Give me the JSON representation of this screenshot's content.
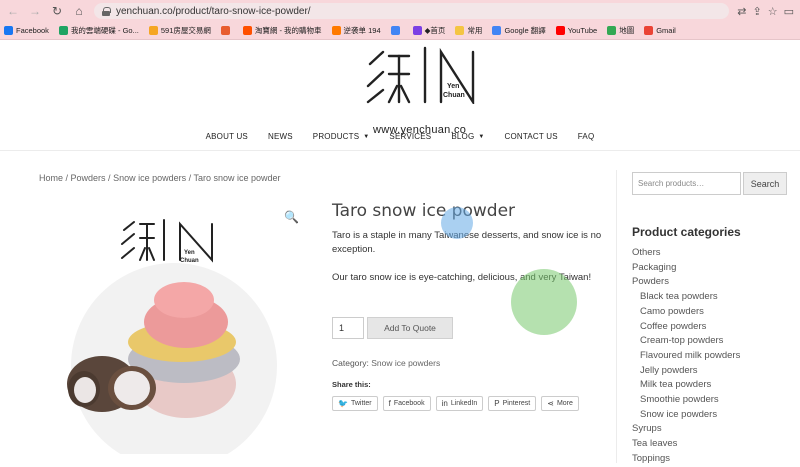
{
  "browser": {
    "url": "yenchuan.co/product/taro-snow-ice-powder/",
    "bookmarks": [
      {
        "label": "Facebook",
        "color": "#1877f2"
      },
      {
        "label": "我的雲端硬碟 - Go...",
        "color": "#1fa463"
      },
      {
        "label": "591房屋交易網",
        "color": "#f5a623"
      },
      {
        "label": "",
        "color": "#e85d2f"
      },
      {
        "label": "淘寶網 - 我的購物車",
        "color": "#ff5000"
      },
      {
        "label": "逆袭单 194",
        "color": "#ff7a00"
      },
      {
        "label": "",
        "color": "#4285f4"
      },
      {
        "label": "◆首页",
        "color": "#7b3fe4"
      },
      {
        "label": "常用",
        "color": "#f4c542"
      },
      {
        "label": "Google 翻譯",
        "color": "#4285f4"
      },
      {
        "label": "YouTube",
        "color": "#ff0000"
      },
      {
        "label": "地圖",
        "color": "#34a853"
      },
      {
        "label": "Gmail",
        "color": "#ea4335"
      }
    ]
  },
  "site": {
    "logo_text": "Yen Chuan",
    "logo_url": "www.yenchuan.co",
    "nav": [
      {
        "label": "ABOUT US",
        "caret": false
      },
      {
        "label": "NEWS",
        "caret": false
      },
      {
        "label": "PRODUCTS",
        "caret": true
      },
      {
        "label": "SERVICES",
        "caret": false
      },
      {
        "label": "BLOG",
        "caret": true
      },
      {
        "label": "CONTACT US",
        "caret": false
      },
      {
        "label": "FAQ",
        "caret": false
      }
    ]
  },
  "breadcrumb": {
    "home": "Home",
    "sep": " / ",
    "powders": "Powders",
    "snow": "Snow ice powders",
    "current": "Taro snow ice powder"
  },
  "product": {
    "title": "Taro snow ice powder",
    "desc1": "Taro is a staple in many Taiwanese desserts, and snow ice is no exception.",
    "desc2": "Our taro snow ice is eye-catching, delicious, and very Taiwan!",
    "qty": "1",
    "add_label": "Add To Quote",
    "category_label": "Category: ",
    "category_value": "Snow ice powders",
    "share_label": "Share this:",
    "shares": [
      "Twitter",
      "Facebook",
      "LinkedIn",
      "Pinterest",
      "More"
    ]
  },
  "sidebar": {
    "search_placeholder": "Search products…",
    "search_button": "Search",
    "categories_title": "Product categories",
    "categories": [
      {
        "label": "Others",
        "sub": false
      },
      {
        "label": "Packaging",
        "sub": false
      },
      {
        "label": "Powders",
        "sub": false
      },
      {
        "label": "Black tea powders",
        "sub": true
      },
      {
        "label": "Camo powders",
        "sub": true
      },
      {
        "label": "Coffee powders",
        "sub": true
      },
      {
        "label": "Cream-top powders",
        "sub": true
      },
      {
        "label": "Flavoured milk powders",
        "sub": true
      },
      {
        "label": "Jelly powders",
        "sub": true
      },
      {
        "label": "Milk tea powders",
        "sub": true
      },
      {
        "label": "Smoothie powders",
        "sub": true
      },
      {
        "label": "Snow ice powders",
        "sub": true
      },
      {
        "label": "Syrups",
        "sub": false
      },
      {
        "label": "Tea leaves",
        "sub": false
      },
      {
        "label": "Toppings",
        "sub": false
      }
    ]
  }
}
